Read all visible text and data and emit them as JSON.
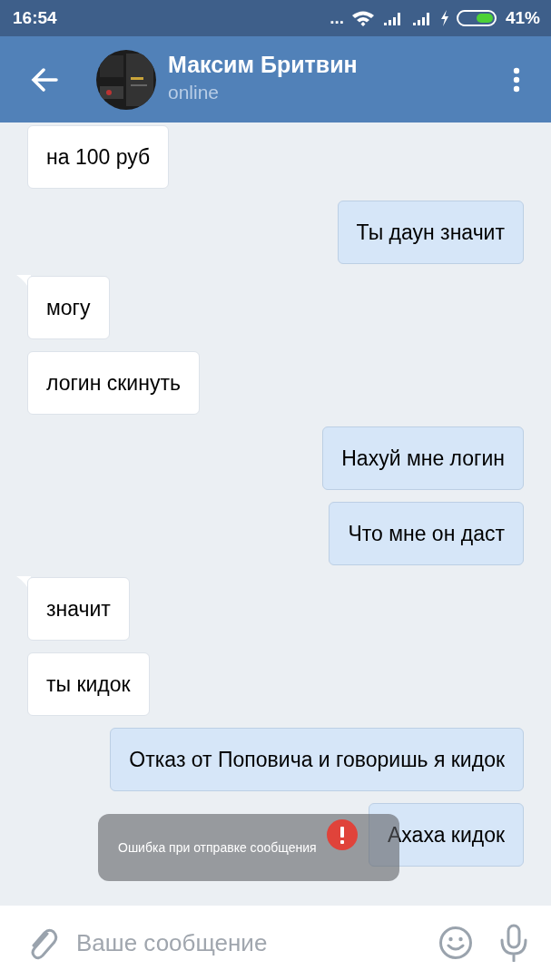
{
  "status_bar": {
    "time": "16:54",
    "dots": "...",
    "battery_text": "41%"
  },
  "header": {
    "name": "Максим Бритвин",
    "status": "online"
  },
  "messages": [
    {
      "text": "на 100 руб",
      "outgoing": false,
      "tail": false,
      "failed": false
    },
    {
      "text": "Ты даун значит",
      "outgoing": true,
      "tail": false,
      "failed": false
    },
    {
      "text": "могу",
      "outgoing": false,
      "tail": true,
      "failed": false
    },
    {
      "text": "логин скинуть",
      "outgoing": false,
      "tail": false,
      "failed": false
    },
    {
      "text": "Нахуй мне логин",
      "outgoing": true,
      "tail": false,
      "failed": false
    },
    {
      "text": "Что мне он даст",
      "outgoing": true,
      "tail": false,
      "failed": false
    },
    {
      "text": "значит",
      "outgoing": false,
      "tail": true,
      "failed": false
    },
    {
      "text": "ты кидок",
      "outgoing": false,
      "tail": false,
      "failed": false
    },
    {
      "text": "Отказ от Поповича и говоришь я кидок",
      "outgoing": true,
      "tail": false,
      "failed": false
    },
    {
      "text": "Ахаха кидок",
      "outgoing": true,
      "tail": false,
      "failed": true
    }
  ],
  "toast": {
    "text": "Ошибка при отправке сообщения"
  },
  "composer": {
    "placeholder": "Ваше сообщение"
  }
}
